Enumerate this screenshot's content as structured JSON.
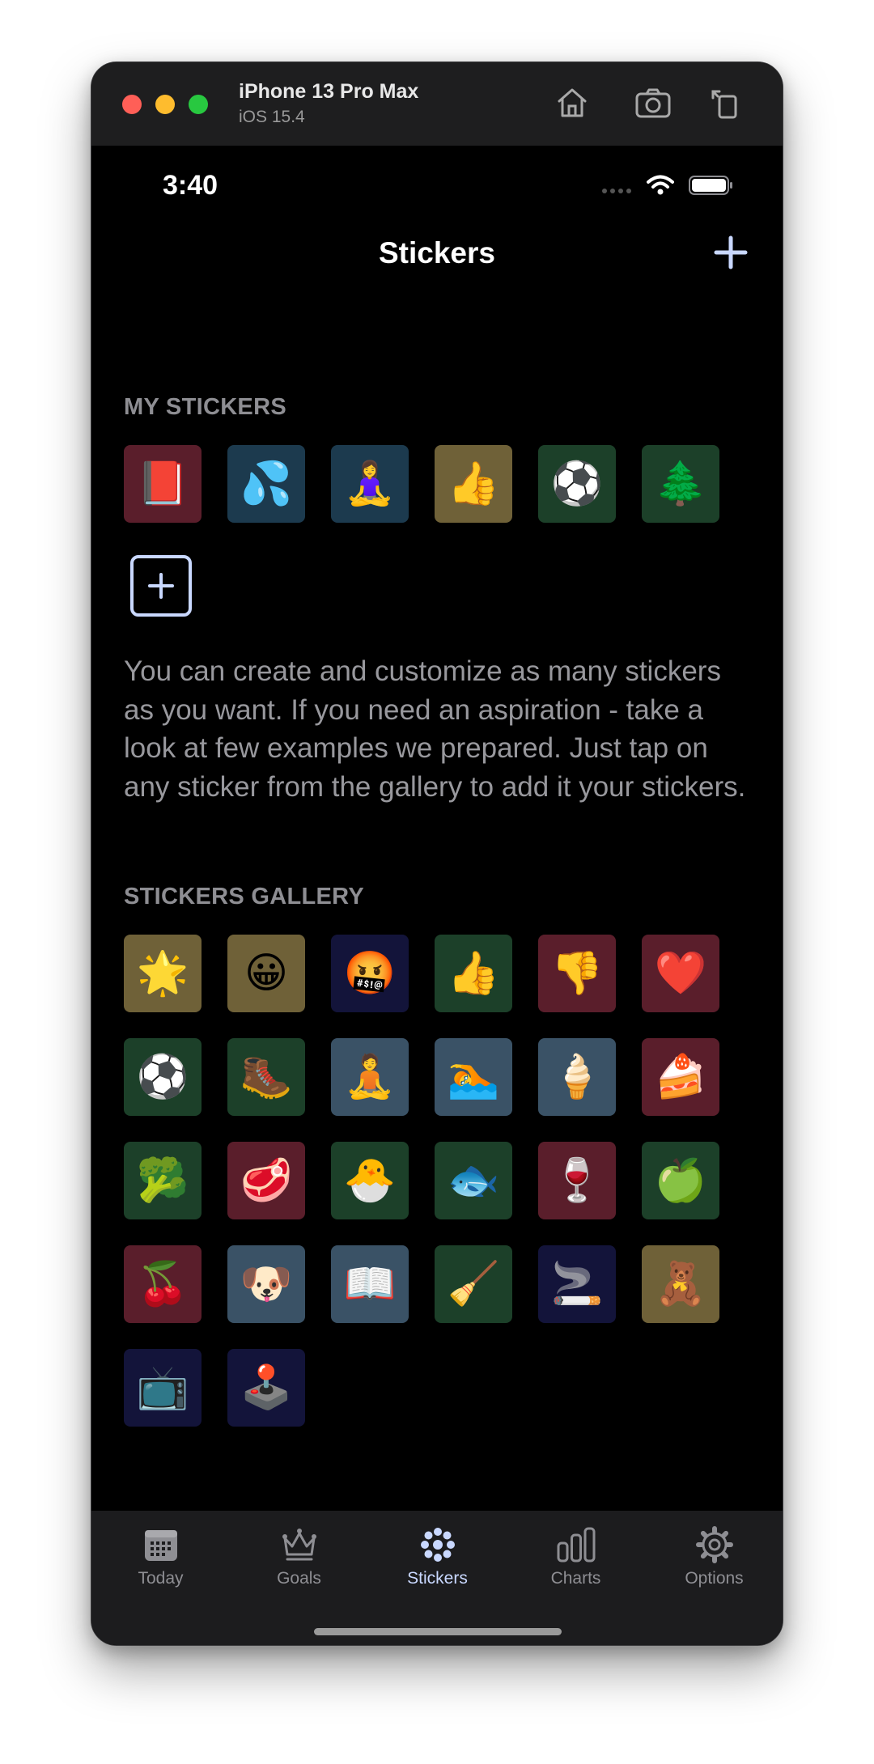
{
  "window": {
    "device_name": "iPhone 13 Pro Max",
    "os_version": "iOS 15.4"
  },
  "status_bar": {
    "time": "3:40"
  },
  "nav": {
    "title": "Stickers"
  },
  "my_stickers": {
    "header": "MY STICKERS",
    "items": [
      {
        "emoji": "📕",
        "bg": "#5a1e2b"
      },
      {
        "emoji": "💦",
        "bg": "#1c3a4e"
      },
      {
        "emoji": "🧘‍♀️",
        "bg": "#1c3a4e"
      },
      {
        "emoji": "👍",
        "bg": "#6f6138"
      },
      {
        "emoji": "⚽",
        "bg": "#1c4029"
      },
      {
        "emoji": "🌲",
        "bg": "#1c4029"
      }
    ]
  },
  "description": "You can create and customize as many stickers as you want. If you need an aspiration - take a look at few examples we prepared. Just tap on any sticker from the gallery to add it your stickers.",
  "gallery": {
    "header": "STICKERS GALLERY",
    "items": [
      {
        "emoji": "🌟",
        "bg": "#6f6138"
      },
      {
        "emoji": "😀",
        "bg": "#6f6138"
      },
      {
        "emoji": "🤬",
        "bg": "#13143a"
      },
      {
        "emoji": "👍",
        "bg": "#1c4029"
      },
      {
        "emoji": "👎",
        "bg": "#5a1e2b"
      },
      {
        "emoji": "❤️",
        "bg": "#5a1e2b"
      },
      {
        "emoji": "⚽",
        "bg": "#1c4029"
      },
      {
        "emoji": "🥾",
        "bg": "#1c4029"
      },
      {
        "emoji": "🧘",
        "bg": "#3a5266"
      },
      {
        "emoji": "🏊",
        "bg": "#3a5266"
      },
      {
        "emoji": "🍦",
        "bg": "#3a5266"
      },
      {
        "emoji": "🍰",
        "bg": "#5a1e2b"
      },
      {
        "emoji": "🥦",
        "bg": "#1c4029"
      },
      {
        "emoji": "🥩",
        "bg": "#5a1e2b"
      },
      {
        "emoji": "🐣",
        "bg": "#1c4029"
      },
      {
        "emoji": "🐟",
        "bg": "#1c4029"
      },
      {
        "emoji": "🍷",
        "bg": "#5a1e2b"
      },
      {
        "emoji": "🍏",
        "bg": "#1c4029"
      },
      {
        "emoji": "🍒",
        "bg": "#5a1e2b"
      },
      {
        "emoji": "🐶",
        "bg": "#3a5266"
      },
      {
        "emoji": "📖",
        "bg": "#3a5266"
      },
      {
        "emoji": "🧹",
        "bg": "#1c4029"
      },
      {
        "emoji": "🚬",
        "bg": "#13143a"
      },
      {
        "emoji": "🧸",
        "bg": "#6f6138"
      },
      {
        "emoji": "📺",
        "bg": "#13143a"
      },
      {
        "emoji": "🕹️",
        "bg": "#13143a"
      }
    ]
  },
  "tabs": [
    {
      "label": "Today",
      "icon": "calendar-icon"
    },
    {
      "label": "Goals",
      "icon": "crown-icon"
    },
    {
      "label": "Stickers",
      "icon": "dots-flower-icon",
      "active": true
    },
    {
      "label": "Charts",
      "icon": "bar-chart-icon"
    },
    {
      "label": "Options",
      "icon": "gear-icon"
    }
  ],
  "colors": {
    "accent": "#c9d8ff",
    "inactive_tab": "#8e8e93",
    "background": "#000000"
  }
}
